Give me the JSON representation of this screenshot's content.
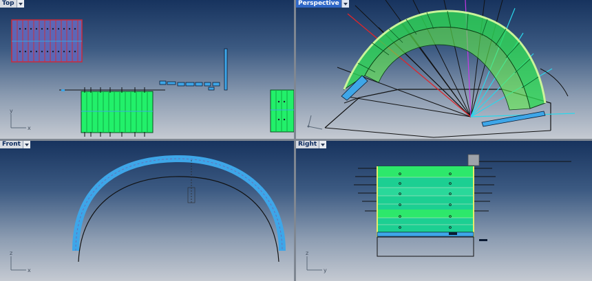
{
  "viewports": {
    "top": {
      "label": "Top",
      "active": false
    },
    "perspective": {
      "label": "Perspective",
      "active": true
    },
    "front": {
      "label": "Front",
      "active": false
    },
    "right": {
      "label": "Right",
      "active": false
    }
  },
  "axes": {
    "top": {
      "x": "x",
      "y": "y"
    },
    "persp": {
      "x": "x",
      "y": "y"
    },
    "front": {
      "x": "x",
      "y": "z"
    },
    "right": {
      "x": "y",
      "y": "z"
    }
  },
  "icons": {
    "viewport_menu": "chevron-down-icon"
  },
  "colors": {
    "viewport_gradient_top": "#17335e",
    "viewport_gradient_bottom": "#c5cad2",
    "active_tab": "#2f67c7",
    "panel_green": "#22f06a",
    "panel_blue": "#3ea6e8",
    "accent_cyan": "#29d8ec",
    "accent_red": "#e0252a"
  }
}
